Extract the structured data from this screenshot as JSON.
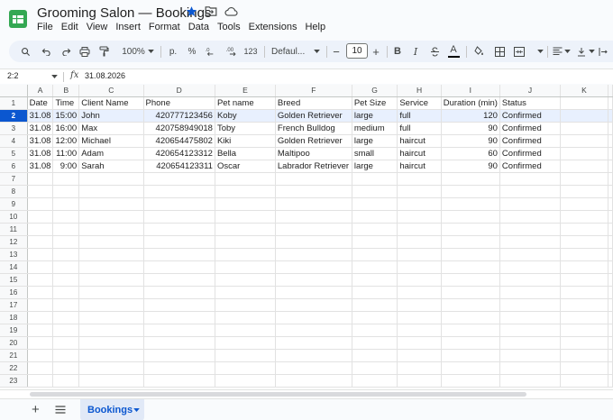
{
  "app": {
    "title": "Grooming Salon — Bookings",
    "menus": [
      "File",
      "Edit",
      "View",
      "Insert",
      "Format",
      "Data",
      "Tools",
      "Extensions",
      "Help"
    ],
    "icons": [
      "sheets-logo",
      "star-icon",
      "move-folder-icon",
      "cloud-saved-icon"
    ],
    "accent": "#0b57d0"
  },
  "toolbar": {
    "zoom": "100%",
    "currency": "р.",
    "percent": "%",
    "decrease_decimal": ".0",
    "increase_decimal": ".00",
    "number_format": "123",
    "font": "Defaul...",
    "font_size": "10",
    "minus": "−",
    "plus": "+",
    "bold": "B",
    "italic": "I",
    "text_color": "A"
  },
  "formula_bar": {
    "name_box": "2:2",
    "fx": "fx",
    "value": "31.08.2026"
  },
  "grid": {
    "columns": [
      "A",
      "B",
      "C",
      "D",
      "E",
      "F",
      "G",
      "H",
      "I",
      "J",
      "K"
    ],
    "headers": [
      "Date",
      "Time",
      "Client Name",
      "Phone",
      "Pet name",
      "Breed",
      "Pet Size",
      "Service",
      "Duration (min)",
      "Status"
    ],
    "rows": [
      [
        "31.08",
        "15:00",
        "John",
        "420777123456",
        "Koby",
        "Golden Retriever",
        "large",
        "full",
        "120",
        "Confirmed"
      ],
      [
        "31.08",
        "16:00",
        "Max",
        "420758949018",
        "Toby",
        "French Bulldog",
        "medium",
        "full",
        "90",
        "Confirmed"
      ],
      [
        "31.08",
        "12:00",
        "Michael",
        "420654475802",
        "Kiki",
        "Golden Retriever",
        "large",
        "haircut",
        "90",
        "Confirmed"
      ],
      [
        "31.08",
        "11:00",
        "Adam",
        "420654123312",
        "Bella",
        "Maltipoo",
        "small",
        "haircut",
        "60",
        "Confirmed"
      ],
      [
        "31.08",
        "9:00",
        "Sarah",
        "420654123311",
        "Oscar",
        "Labrador Retriever",
        "large",
        "haircut",
        "90",
        "Confirmed"
      ]
    ],
    "row_numbers": [
      "1",
      "2",
      "3",
      "4",
      "5",
      "6",
      "7",
      "8",
      "9",
      "10",
      "11",
      "12",
      "13",
      "14",
      "15",
      "16",
      "17",
      "18",
      "19",
      "20",
      "21",
      "22",
      "23"
    ],
    "selected_row": "2"
  },
  "sheets": {
    "add": "+",
    "tabs": [
      {
        "label": "Bookings",
        "active": true
      }
    ]
  }
}
